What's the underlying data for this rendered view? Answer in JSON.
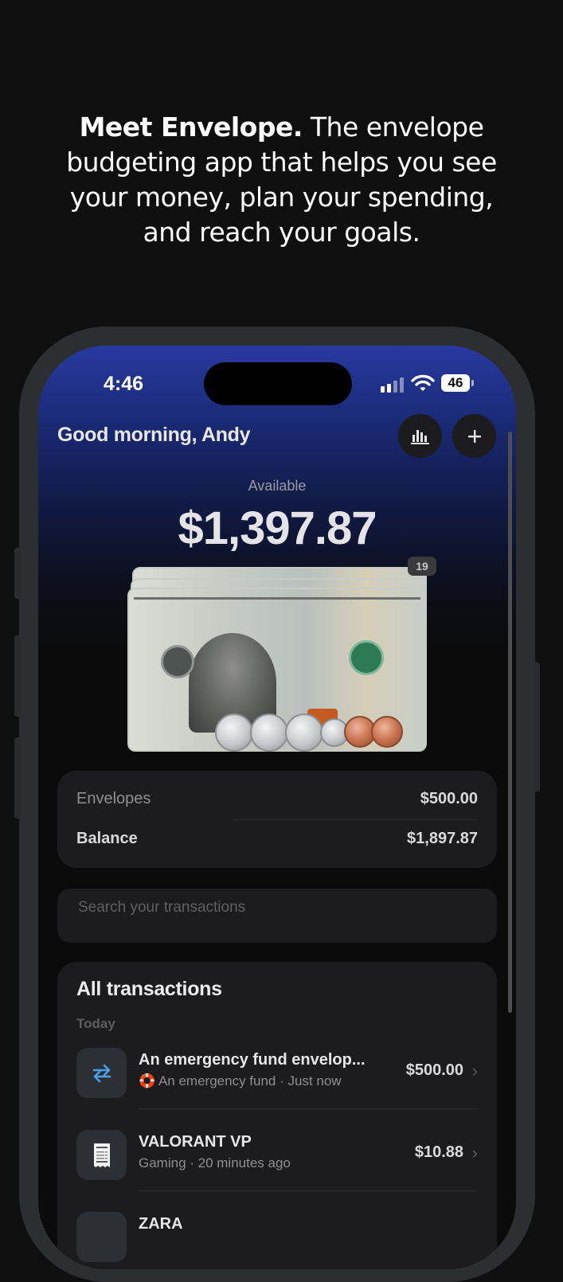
{
  "marketing": {
    "headline_bold": "Meet Envelope.",
    "headline_rest": " The envelope budgeting app that helps you see your money, plan your spending, and reach your goals."
  },
  "status_bar": {
    "time": "4:46",
    "battery": "46"
  },
  "header": {
    "greeting": "Good morning, Andy",
    "stats_icon": "bar-chart-icon",
    "add_icon": "plus-icon"
  },
  "available": {
    "label": "Available",
    "amount": "$1,397.87",
    "badge": "19"
  },
  "summary": {
    "envelopes_label": "Envelopes",
    "envelopes_value": "$500.00",
    "balance_label": "Balance",
    "balance_value": "$1,897.87"
  },
  "search": {
    "placeholder": "Search your transactions"
  },
  "transactions": {
    "title": "All transactions",
    "section": "Today",
    "items": [
      {
        "name": "An emergency fund envelop...",
        "meta": "🛟 An emergency fund · Just now",
        "amount": "$500.00",
        "icon": "transfer-icon"
      },
      {
        "name": "VALORANT VP",
        "meta": "Gaming · 20 minutes ago",
        "amount": "$10.88",
        "icon": "receipt-icon"
      },
      {
        "name": "ZARA",
        "meta": "",
        "amount": "",
        "icon": "receipt-icon"
      }
    ]
  },
  "colors": {
    "accent_blue": "#283aa0",
    "card": "#1c1c1e",
    "background": "#0f0f0f"
  }
}
